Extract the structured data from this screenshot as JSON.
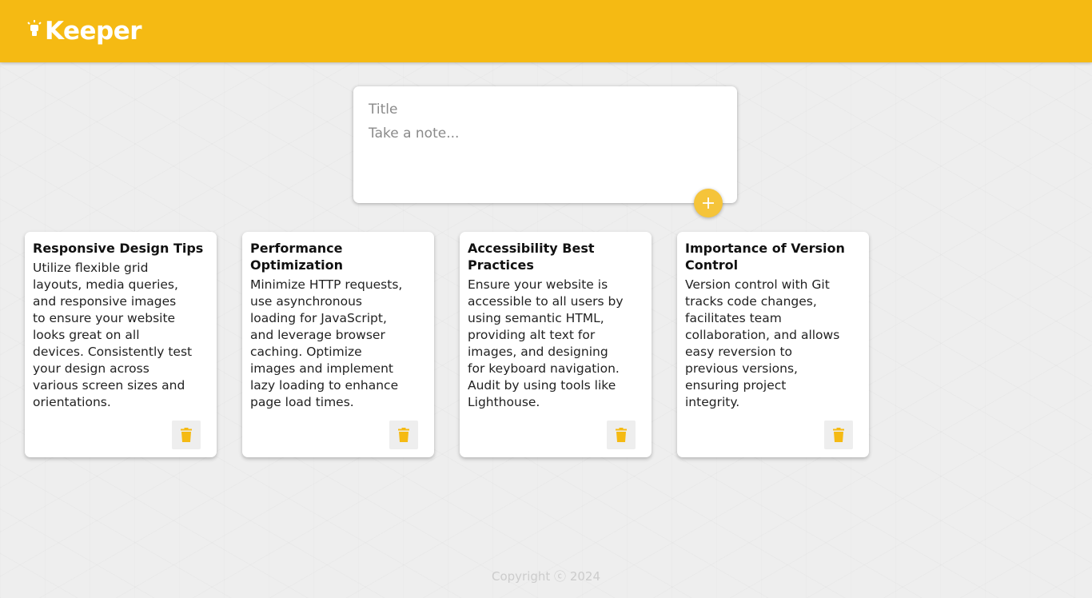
{
  "header": {
    "brand": "Keeper",
    "accent_color": "#f5ba13",
    "logo_icon": "lightbulb-icon"
  },
  "composer": {
    "title_placeholder": "Title",
    "content_placeholder": "Take a note...",
    "add_icon": "plus-icon"
  },
  "notes": [
    {
      "title": "Responsive Design Tips",
      "content": "Utilize flexible grid\nlayouts, media queries,\nand responsive images\nto ensure your website\nlooks great on all\ndevices. Consistently test\nyour design across\nvarious screen sizes and\norientations."
    },
    {
      "title": "Performance\nOptimization",
      "content": "Minimize HTTP requests,\nuse asynchronous\nloading for JavaScript,\nand leverage browser\ncaching. Optimize\nimages and implement\nlazy loading to enhance\npage load times."
    },
    {
      "title": "Accessibility Best\nPractices",
      "content": "Ensure your website is\naccessible to all users by\nusing semantic HTML,\nproviding alt text for\nimages, and designing\nfor keyboard navigation.\nAudit by using tools like\nLighthouse."
    },
    {
      "title": "Importance of Version\nControl",
      "content": "Version control with Git\ntracks code changes,\nfacilitates team\ncollaboration, and allows\neasy reversion to\nprevious versions,\nensuring project\nintegrity."
    }
  ],
  "delete_icon": "trash-icon",
  "footer": {
    "copyright": "Copyright ⓒ 2024"
  }
}
